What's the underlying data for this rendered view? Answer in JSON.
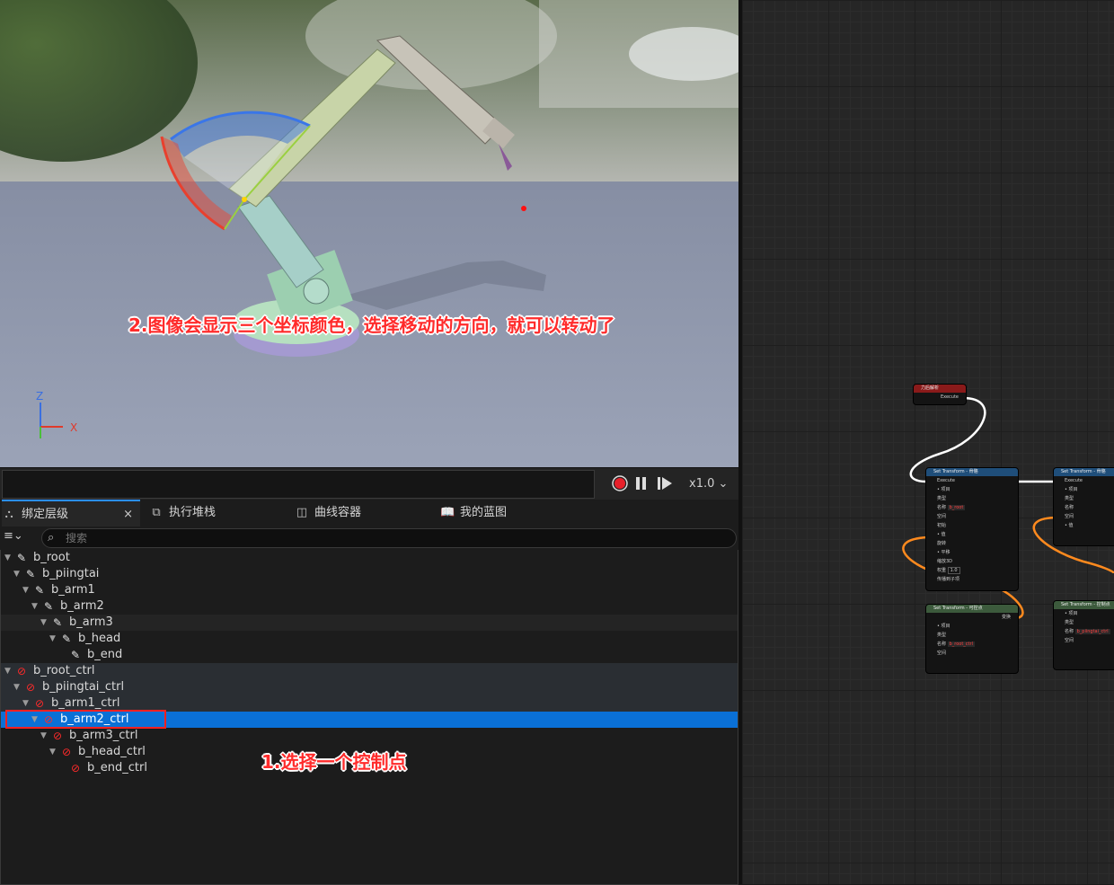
{
  "annotations": {
    "step2": "2.图像会显示三个坐标颜色，选择移动的方向，就可以转动了",
    "step1": "1.选择一个控制点"
  },
  "viewport": {
    "axis_z": "Z",
    "axis_x": "X"
  },
  "transport": {
    "speed": "x1.0"
  },
  "tabs": [
    {
      "label": "绑定层级",
      "close": "×"
    },
    {
      "label": "执行堆栈"
    },
    {
      "label": "曲线容器"
    },
    {
      "label": "我的蓝图"
    }
  ],
  "search": {
    "placeholder": "搜索"
  },
  "hierarchy": [
    {
      "label": "b_root",
      "type": "bone"
    },
    {
      "label": "b_piingtai",
      "type": "bone"
    },
    {
      "label": "b_arm1",
      "type": "bone"
    },
    {
      "label": "b_arm2",
      "type": "bone"
    },
    {
      "label": "b_arm3",
      "type": "bone"
    },
    {
      "label": "b_head",
      "type": "bone"
    },
    {
      "label": "b_end",
      "type": "bone"
    },
    {
      "label": "b_root_ctrl",
      "type": "control"
    },
    {
      "label": "b_piingtai_ctrl",
      "type": "control"
    },
    {
      "label": "b_arm1_ctrl",
      "type": "control"
    },
    {
      "label": "b_arm2_ctrl",
      "type": "control",
      "selected": true
    },
    {
      "label": "b_arm3_ctrl",
      "type": "control"
    },
    {
      "label": "b_head_ctrl",
      "type": "control"
    },
    {
      "label": "b_end_ctrl",
      "type": "control"
    }
  ],
  "graph": {
    "event_node": {
      "title": "力后解析",
      "pin": "Execute"
    },
    "node_a": {
      "title": "Set Transform - 骨骼",
      "pins": [
        "Execute",
        "• 项目",
        "类型",
        "名称",
        "空间",
        "初始",
        "• 值",
        "旋转",
        "• 平移",
        "缩放3D",
        "权重",
        "传播到子项"
      ],
      "name_value": "b_root",
      "weight_value": "1.0"
    },
    "node_b": {
      "title": "Set Transform - 骨骼",
      "pins": [
        "Execute",
        "• 项目",
        "类型",
        "名称",
        "空间",
        "初始",
        "• 值",
        "权重",
        "传播到子项"
      ],
      "weight_value": "1.0"
    },
    "node_c": {
      "title": "Set Transform - 可控点",
      "out_pin": "变换",
      "pins": [
        "• 项目",
        "类型",
        "名称",
        "空间",
        "初始"
      ],
      "name_value": "b_root_ctrl"
    },
    "node_d": {
      "title": "Set Transform - 控制点",
      "pins": [
        "• 项目",
        "类型",
        "名称",
        "空间",
        "初始"
      ],
      "name_value": "b_piingtai_ctrl"
    },
    "colors": {
      "bone_icon": "#e8e8e8",
      "control_icon": "#ff2a2a",
      "selection": "#0a70d6",
      "exec_wire": "#ffffff",
      "data_wire": "#ff8a1e"
    }
  }
}
